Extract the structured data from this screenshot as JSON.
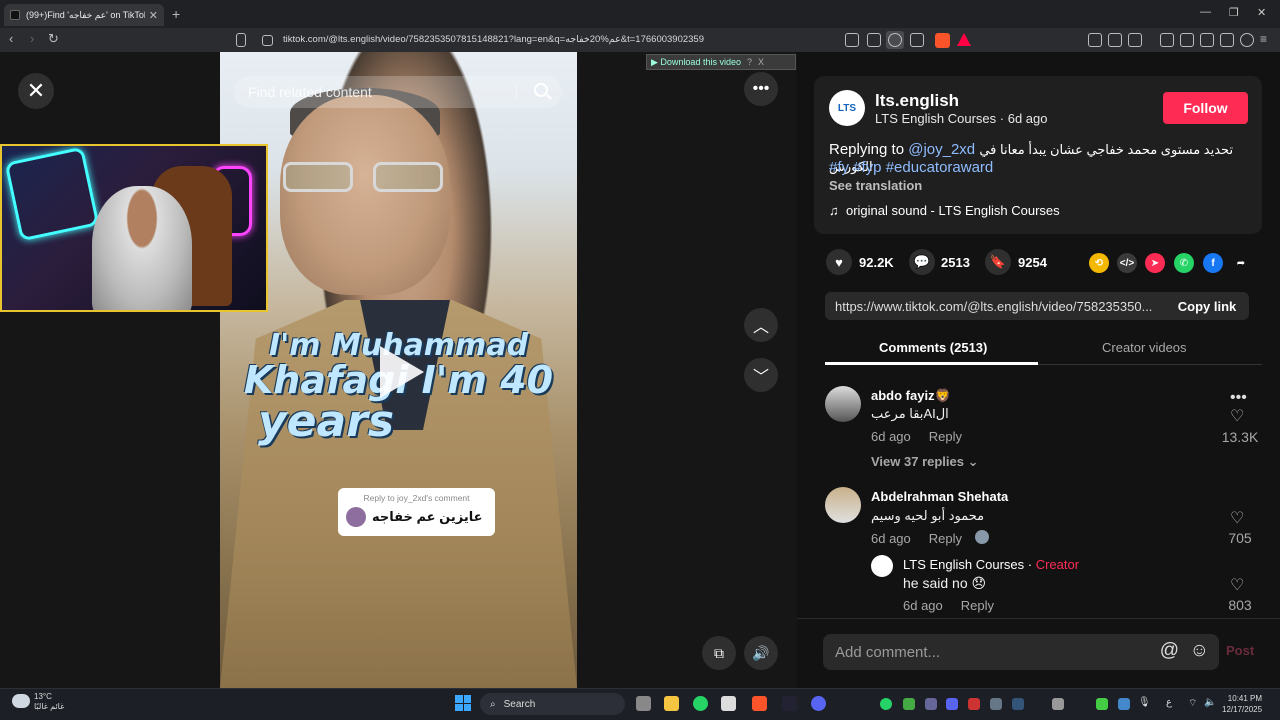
{
  "browser": {
    "tab_title": "(99+)Find 'عم خفاجه' on TikTok |",
    "url": "tiktok.com/@lts.english/video/7582353507815148821?lang=en&q=عم%20خفاجه&t=1766003902359",
    "new_tab": "+",
    "tab_close": "✕"
  },
  "video": {
    "search_placeholder": "Find related content",
    "caption_line1": "I'm Muhammad",
    "caption_line2": "Khafagi I'm 40",
    "caption_line3": "years",
    "reply_bubble_title": "Reply to joy_2xd's comment",
    "reply_bubble_text": "عايزين عم خفاجه",
    "download_label": "▶ Download this video",
    "download_help": "?",
    "download_close": "X"
  },
  "post": {
    "avatar_text": "LTS",
    "username": "lts.english",
    "display_name": "LTS English Courses",
    "sep": " · ",
    "age": "6d ago",
    "follow_label": "Follow",
    "replying_prefix": "Replying to",
    "replying_user": "@joy_2xd",
    "description_ar": "تحديد مستوى محمد خفاجي عشان يبدأ معانا في الكورس",
    "hashtags": "#fy #fyp #educatoraward",
    "see_translation": "See translation",
    "sound": "original sound - LTS English Courses",
    "likes": "92.2K",
    "comments": "2513",
    "saves": "9254",
    "share_url": "https://www.tiktok.com/@lts.english/video/758235350...",
    "copy_link": "Copy link"
  },
  "tabs": {
    "comments": "Comments (2513)",
    "creator_videos": "Creator videos"
  },
  "comments": [
    {
      "name": "abdo fayiz🦁",
      "text": "الAIبقا مرعب",
      "age": "6d ago",
      "reply": "Reply",
      "likes": "13.3K",
      "view_replies": "View 37 replies ⌄"
    },
    {
      "name": "Abdelrahman Shehata",
      "text": "محمود أبو لحيه وسيم",
      "age": "6d ago",
      "reply": "Reply",
      "likes": "705"
    }
  ],
  "nested_reply": {
    "name": "LTS English Courses",
    "sep": " · ",
    "badge": "Creator",
    "text": "he said no 😞",
    "age": "6d ago",
    "reply": "Reply",
    "likes": "803"
  },
  "comment_input": {
    "placeholder": "Add comment...",
    "post": "Post"
  },
  "taskbar": {
    "temp": "13°C",
    "weather_text": "غائم غالبًا",
    "search": "Search",
    "time": "10:41 PM",
    "date": "12/17/2025",
    "lang": "ع"
  },
  "colors": {
    "accent": "#fe2c55",
    "hashtag": "#8fbcff"
  }
}
